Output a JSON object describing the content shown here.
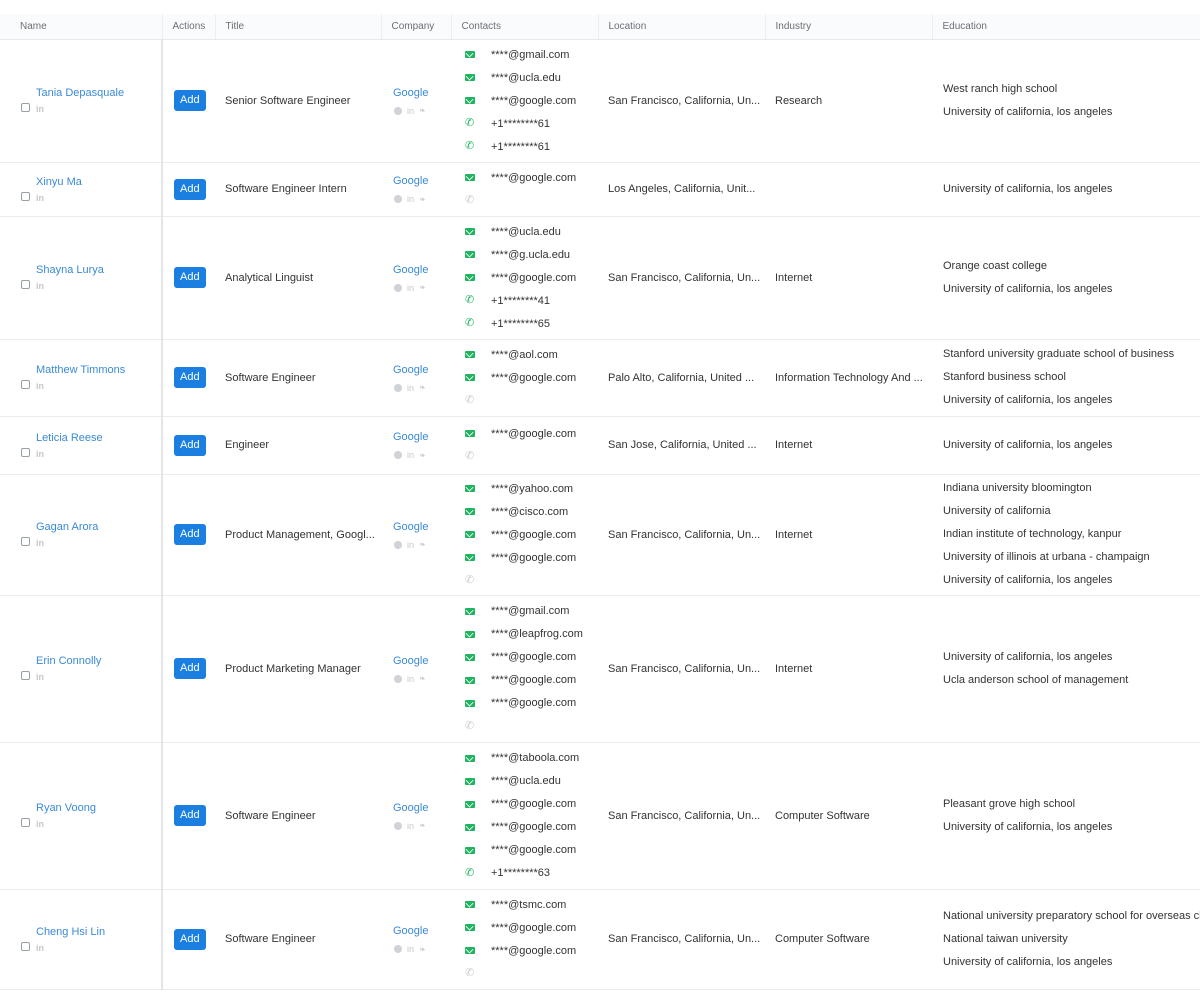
{
  "columns": [
    "Name",
    "Actions",
    "Title",
    "Company",
    "Contacts",
    "Location",
    "Industry",
    "Education"
  ],
  "add_label": "Add",
  "linkedin_glyph": "in",
  "colors": {
    "link": "#3a8ad6",
    "button": "#1a7fe0",
    "contact_icon": "#1fb45f"
  },
  "rows": [
    {
      "name": "Tania Depasquale",
      "title": "Senior Software Engineer",
      "company": "Google",
      "contacts": [
        {
          "type": "email",
          "value": "****@gmail.com"
        },
        {
          "type": "email",
          "value": "****@ucla.edu"
        },
        {
          "type": "email",
          "value": "****@google.com"
        },
        {
          "type": "phone",
          "value": "+1********61"
        },
        {
          "type": "phone",
          "value": "+1********61"
        }
      ],
      "location": "San Francisco, California, Un...",
      "industry": "Research",
      "education": [
        "West ranch high school",
        "University of california, los angeles"
      ]
    },
    {
      "name": "Xinyu Ma",
      "title": "Software Engineer Intern",
      "company": "Google",
      "contacts": [
        {
          "type": "email",
          "value": "****@google.com"
        },
        {
          "type": "phone-empty",
          "value": ""
        }
      ],
      "location": "Los Angeles, California, Unit...",
      "industry": "",
      "education": [
        "University of california, los angeles"
      ]
    },
    {
      "name": "Shayna Lurya",
      "title": "Analytical Linguist",
      "company": "Google",
      "contacts": [
        {
          "type": "email",
          "value": "****@ucla.edu"
        },
        {
          "type": "email",
          "value": "****@g.ucla.edu"
        },
        {
          "type": "email",
          "value": "****@google.com"
        },
        {
          "type": "phone",
          "value": "+1********41"
        },
        {
          "type": "phone",
          "value": "+1********65"
        }
      ],
      "location": "San Francisco, California, Un...",
      "industry": "Internet",
      "education": [
        "Orange coast college",
        "University of california, los angeles"
      ]
    },
    {
      "name": "Matthew Timmons",
      "title": "Software Engineer",
      "company": "Google",
      "contacts": [
        {
          "type": "email",
          "value": "****@aol.com"
        },
        {
          "type": "email",
          "value": "****@google.com"
        },
        {
          "type": "phone-empty",
          "value": ""
        }
      ],
      "location": "Palo Alto, California, United ...",
      "industry": "Information Technology And ...",
      "education": [
        "Stanford university graduate school of business",
        "Stanford business school",
        "University of california, los angeles"
      ]
    },
    {
      "name": "Leticia Reese",
      "title": "Engineer",
      "company": "Google",
      "contacts": [
        {
          "type": "email",
          "value": "****@google.com"
        },
        {
          "type": "phone-empty",
          "value": ""
        }
      ],
      "location": "San Jose, California, United ...",
      "industry": "Internet",
      "education": [
        "University of california, los angeles"
      ]
    },
    {
      "name": "Gagan Arora",
      "title": "Product Management, Googl...",
      "company": "Google",
      "contacts": [
        {
          "type": "email",
          "value": "****@yahoo.com"
        },
        {
          "type": "email",
          "value": "****@cisco.com"
        },
        {
          "type": "email",
          "value": "****@google.com"
        },
        {
          "type": "email",
          "value": "****@google.com"
        },
        {
          "type": "phone-empty",
          "value": ""
        }
      ],
      "location": "San Francisco, California, Un...",
      "industry": "Internet",
      "education": [
        "Indiana university bloomington",
        "University of california",
        "Indian institute of technology, kanpur",
        "University of illinois at urbana - champaign",
        "University of california, los angeles"
      ]
    },
    {
      "name": "Erin Connolly",
      "title": "Product Marketing Manager",
      "company": "Google",
      "contacts": [
        {
          "type": "email",
          "value": "****@gmail.com"
        },
        {
          "type": "email",
          "value": "****@leapfrog.com"
        },
        {
          "type": "email",
          "value": "****@google.com"
        },
        {
          "type": "email",
          "value": "****@google.com"
        },
        {
          "type": "email",
          "value": "****@google.com"
        },
        {
          "type": "phone-empty",
          "value": ""
        }
      ],
      "location": "San Francisco, California, Un...",
      "industry": "Internet",
      "education": [
        "University of california, los angeles",
        "Ucla anderson school of management"
      ]
    },
    {
      "name": "Ryan Voong",
      "title": "Software Engineer",
      "company": "Google",
      "contacts": [
        {
          "type": "email",
          "value": "****@taboola.com"
        },
        {
          "type": "email",
          "value": "****@ucla.edu"
        },
        {
          "type": "email",
          "value": "****@google.com"
        },
        {
          "type": "email",
          "value": "****@google.com"
        },
        {
          "type": "email",
          "value": "****@google.com"
        },
        {
          "type": "phone",
          "value": "+1********63"
        }
      ],
      "location": "San Francisco, California, Un...",
      "industry": "Computer Software",
      "education": [
        "Pleasant grove high school",
        "University of california, los angeles"
      ]
    },
    {
      "name": "Cheng Hsi Lin",
      "title": "Software Engineer",
      "company": "Google",
      "contacts": [
        {
          "type": "email",
          "value": "****@tsmc.com"
        },
        {
          "type": "email",
          "value": "****@google.com"
        },
        {
          "type": "email",
          "value": "****@google.com"
        },
        {
          "type": "phone-empty",
          "value": ""
        }
      ],
      "location": "San Francisco, California, Un...",
      "industry": "Computer Software",
      "education": [
        "National university preparatory school for overseas chi",
        "National taiwan university",
        "University of california, los angeles"
      ]
    }
  ]
}
